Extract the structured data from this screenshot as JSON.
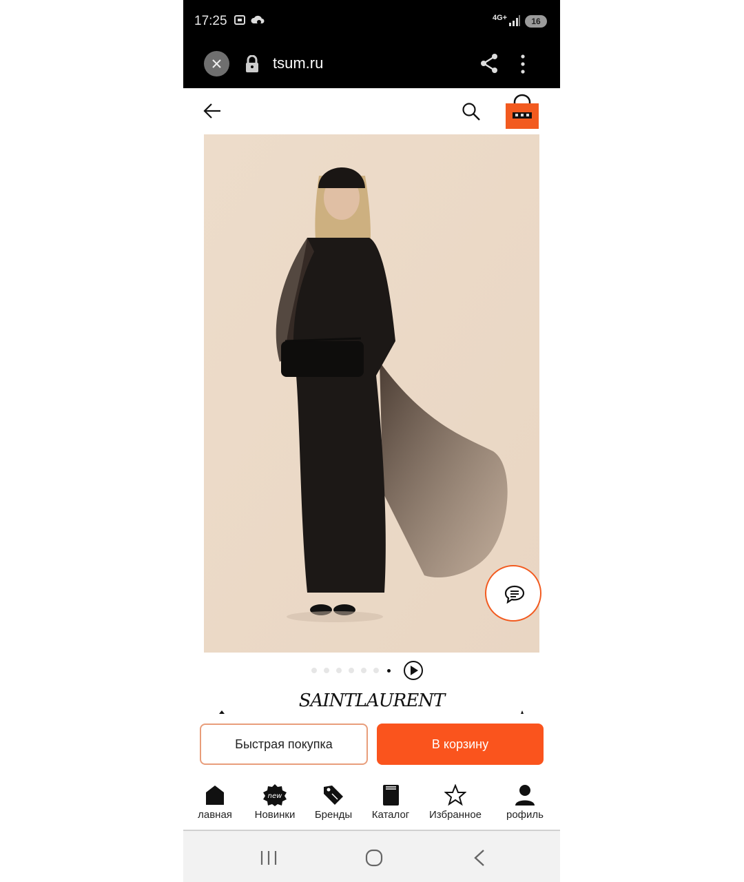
{
  "status_bar": {
    "time": "17:25",
    "network": "4G+",
    "battery": "16"
  },
  "browser": {
    "url": "tsum.ru"
  },
  "carousel": {
    "total": 7,
    "active": 6
  },
  "product": {
    "brand": "SAINTLAURENT"
  },
  "actions": {
    "quick_buy": "Быстрая покупка",
    "add_to_cart": "В корзину"
  },
  "bottom_nav": {
    "items": [
      {
        "label": "лавная",
        "icon": "home-icon"
      },
      {
        "label": "Новинки",
        "icon": "new-badge-icon",
        "badge": "new"
      },
      {
        "label": "Бренды",
        "icon": "tag-icon"
      },
      {
        "label": "Каталог",
        "icon": "book-icon"
      },
      {
        "label": "Избранное",
        "icon": "star-icon"
      },
      {
        "label": "рофиль",
        "icon": "profile-icon"
      }
    ]
  },
  "colors": {
    "accent": "#fa541d",
    "status_bar": "#000000",
    "image_bg": "#ecdccb"
  }
}
